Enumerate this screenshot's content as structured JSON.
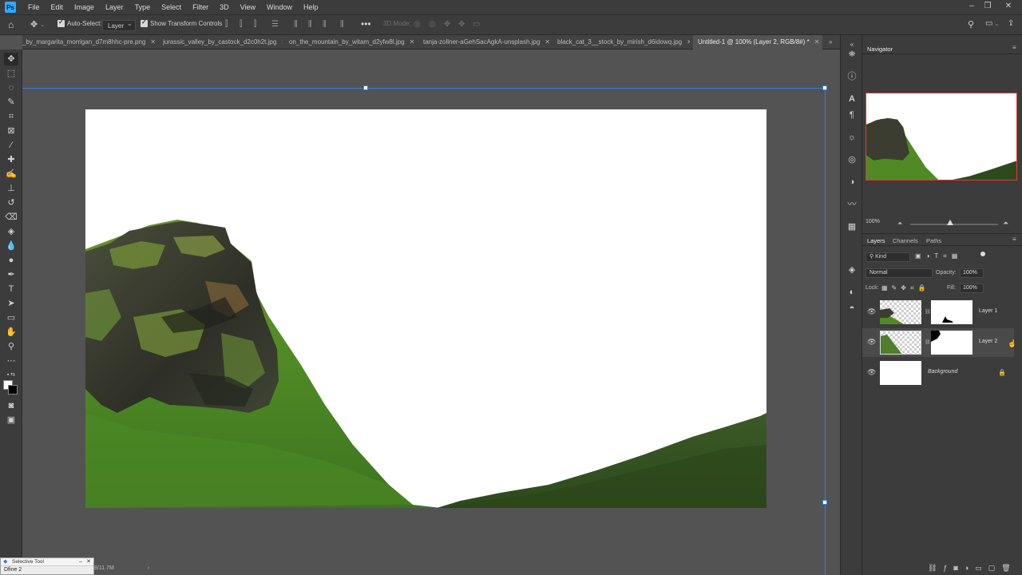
{
  "app": {
    "logo": "Ps"
  },
  "menu": [
    "File",
    "Edit",
    "Image",
    "Layer",
    "Type",
    "Select",
    "Filter",
    "3D",
    "View",
    "Window",
    "Help"
  ],
  "options": {
    "auto_select_label": "Auto-Select:",
    "auto_select_value": "Layer",
    "show_transform_label": "Show Transform Controls",
    "mode_3d_label": "3D Mode:"
  },
  "tabs": [
    {
      "label": "_by_margarita_morrigan_d7m8hhc-pre.png",
      "active": false
    },
    {
      "label": "jurassic_valley_by_castock_d2c0h2t.jpg",
      "active": false
    },
    {
      "label": "on_the_mountain_by_witam_d2yfw8l.jpg",
      "active": false
    },
    {
      "label": "tanja-zollner-aGehSacAgkA-unsplash.jpg",
      "active": false
    },
    {
      "label": "black_cat_3__stock_by_mirish_d6idowq.jpg",
      "active": false
    },
    {
      "label": "Untitled-1 @ 100% (Layer 2, RGB/8#) *",
      "active": true
    }
  ],
  "navigator": {
    "title": "Navigator",
    "zoom": "100%"
  },
  "layers_panel": {
    "tabs": [
      "Layers",
      "Channels",
      "Paths"
    ],
    "filter": "Kind",
    "blend_mode": "Normal",
    "opacity_label": "Opacity:",
    "opacity": "100%",
    "lock_label": "Lock:",
    "fill_label": "Fill:",
    "fill": "100%",
    "layers": [
      {
        "name": "Layer 1",
        "selected": false
      },
      {
        "name": "Layer 2",
        "selected": true
      },
      {
        "name": "Background",
        "selected": false
      }
    ]
  },
  "float_panel": {
    "title": "Selective Tool",
    "item": "Dfine 2"
  },
  "status": {
    "text": "8/11.7M"
  }
}
